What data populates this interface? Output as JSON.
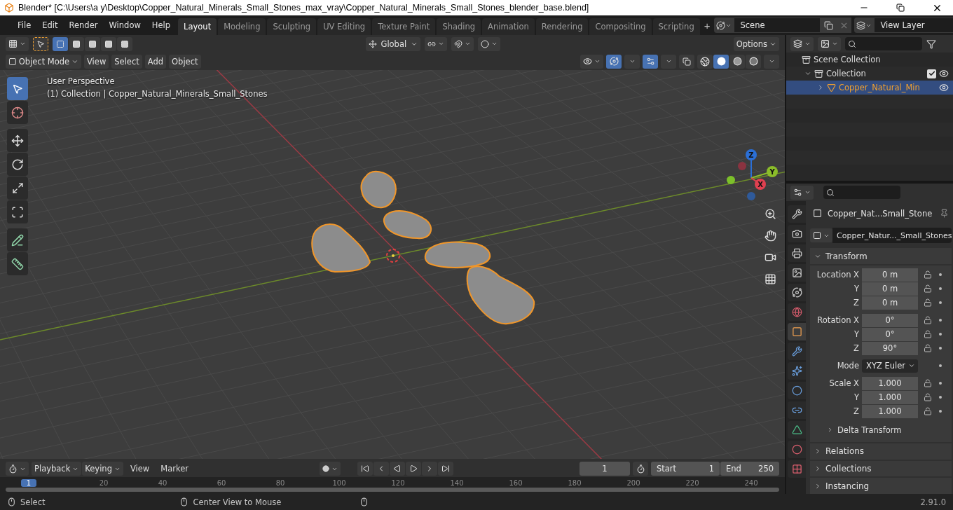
{
  "window": {
    "title": "Blender* [C:\\Users\\a y\\Desktop\\Copper_Natural_Minerals_Small_Stones_max_vray\\Copper_Natural_Minerals_Small_Stones_blender_base.blend]"
  },
  "menu": [
    "File",
    "Edit",
    "Render",
    "Window",
    "Help"
  ],
  "workspaces": [
    {
      "label": "Layout",
      "selected": true
    },
    {
      "label": "Modeling",
      "selected": false
    },
    {
      "label": "Sculpting",
      "selected": false
    },
    {
      "label": "UV Editing",
      "selected": false
    },
    {
      "label": "Texture Paint",
      "selected": false
    },
    {
      "label": "Shading",
      "selected": false
    },
    {
      "label": "Animation",
      "selected": false
    },
    {
      "label": "Rendering",
      "selected": false
    },
    {
      "label": "Compositing",
      "selected": false
    },
    {
      "label": "Scripting",
      "selected": false
    }
  ],
  "add_workspace": "+",
  "scene": {
    "name": "Scene"
  },
  "view_layer": {
    "name": "View Layer"
  },
  "tool_header": {
    "select_modes": [
      {
        "selected": true
      },
      {
        "selected": false
      },
      {
        "selected": false
      },
      {
        "selected": false
      },
      {
        "selected": false
      }
    ],
    "orientation": "Global",
    "options": "Options"
  },
  "viewport_header": {
    "mode": "Object Mode",
    "menus": [
      "View",
      "Select",
      "Add",
      "Object"
    ],
    "shading": [
      {
        "kind": "wireframe",
        "selected": false
      },
      {
        "kind": "solid",
        "selected": true
      },
      {
        "kind": "material",
        "selected": false
      },
      {
        "kind": "rendered",
        "selected": false
      }
    ]
  },
  "viewport": {
    "view_name": "User Perspective",
    "context": "(1) Collection | Copper_Natural_Minerals_Small_Stones",
    "gizmo": [
      {
        "label": "Z",
        "kind": "z"
      },
      {
        "label": "Y",
        "kind": "y"
      },
      {
        "label": "X",
        "kind": "x"
      }
    ]
  },
  "tools": [
    {
      "kind": "select",
      "selected": true
    },
    {
      "kind": "cursor",
      "selected": false
    },
    {
      "kind": "move",
      "selected": false
    },
    {
      "kind": "rotate",
      "selected": false
    },
    {
      "kind": "scale",
      "selected": false
    },
    {
      "kind": "transform",
      "selected": false
    },
    {
      "kind": "annotate",
      "selected": false
    },
    {
      "kind": "measure",
      "selected": false
    }
  ],
  "outliner": {
    "items": [
      {
        "label": "Scene Collection",
        "selected": false,
        "children": [
          {
            "label": "Collection",
            "selected": false,
            "expanded": true,
            "checked": true,
            "children": [
              {
                "label": "Copper_Natural_Min",
                "selected": true,
                "expanded": false
              }
            ]
          }
        ]
      }
    ]
  },
  "properties": {
    "object_name": "Copper_Nat...Small_Stone",
    "data_name": "Copper_Natur..._Small_Stones",
    "tabs": [
      {
        "kind": "tool",
        "selected": false
      },
      {
        "kind": "render",
        "selected": false
      },
      {
        "kind": "output",
        "selected": false
      },
      {
        "kind": "view_layer",
        "selected": false
      },
      {
        "kind": "scene",
        "selected": false
      },
      {
        "kind": "world",
        "selected": false
      },
      {
        "kind": "object",
        "selected": true
      },
      {
        "kind": "modifiers",
        "selected": false
      },
      {
        "kind": "particles",
        "selected": false
      },
      {
        "kind": "physics",
        "selected": false
      },
      {
        "kind": "constraints",
        "selected": false
      },
      {
        "kind": "data",
        "selected": false
      },
      {
        "kind": "material",
        "selected": false
      },
      {
        "kind": "texture",
        "selected": false
      }
    ],
    "panels": [
      {
        "title": "Transform",
        "expanded": true,
        "groups": [
          {
            "rows": [
              {
                "label": "Location X",
                "value": "0 m",
                "kind": "number"
              },
              {
                "label": "Y",
                "value": "0 m",
                "kind": "number"
              },
              {
                "label": "Z",
                "value": "0 m",
                "kind": "number"
              }
            ]
          },
          {
            "rows": [
              {
                "label": "Rotation X",
                "value": "0°",
                "kind": "number"
              },
              {
                "label": "Y",
                "value": "0°",
                "kind": "number"
              },
              {
                "label": "Z",
                "value": "90°",
                "kind": "number"
              }
            ]
          },
          {
            "rows": [
              {
                "label": "Mode",
                "value": "XYZ Euler",
                "kind": "dropdown"
              }
            ]
          },
          {
            "rows": [
              {
                "label": "Scale X",
                "value": "1.000",
                "kind": "number"
              },
              {
                "label": "Y",
                "value": "1.000",
                "kind": "number"
              },
              {
                "label": "Z",
                "value": "1.000",
                "kind": "number"
              }
            ]
          }
        ],
        "subpanels": [
          {
            "title": "Delta Transform",
            "expanded": false
          }
        ]
      },
      {
        "title": "Relations",
        "expanded": false
      },
      {
        "title": "Collections",
        "expanded": false
      },
      {
        "title": "Instancing",
        "expanded": false
      }
    ]
  },
  "timeline": {
    "menus": [
      "Playback",
      "Keying",
      "View",
      "Marker"
    ],
    "current_frame": "1",
    "start_label": "Start",
    "start": "1",
    "end_label": "End",
    "end": "250",
    "ruler": {
      "current": "1",
      "ticks": [
        "20",
        "40",
        "60",
        "80",
        "100",
        "120",
        "140",
        "160",
        "180",
        "200",
        "220",
        "240"
      ]
    }
  },
  "status_bar": {
    "items": [
      "Select",
      "Center View to Mouse"
    ],
    "version": "2.91.0"
  }
}
